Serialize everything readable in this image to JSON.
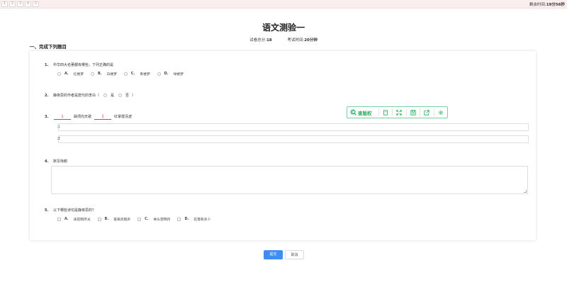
{
  "nav": {
    "question_numbers": [
      "1",
      "2",
      "3",
      "4",
      "5"
    ]
  },
  "timer": {
    "label": "剩余时间:",
    "value": "19分56秒"
  },
  "header": {
    "title": "语文测验一",
    "total_label": "试卷总分:",
    "total_value": "18",
    "time_label": "考试时间:",
    "time_value": "20分钟"
  },
  "section_title": "一、完成下列题目",
  "questions": {
    "q1": {
      "num": "1.",
      "text": "中华四大名著都有哪些，下列正确的是",
      "options": [
        {
          "letter": "A.",
          "text": "红楼梦"
        },
        {
          "letter": "B.",
          "text": "白楼梦"
        },
        {
          "letter": "C.",
          "text": "青楼梦"
        },
        {
          "letter": "D.",
          "text": "绿楼梦"
        }
      ]
    },
    "q2": {
      "num": "2.",
      "text": "静夜思的作者是唐代的李白（",
      "yes": "是",
      "no": "否",
      "close": "）"
    },
    "q3": {
      "num": "3.",
      "blank1": "1",
      "mid": "曲项向天歌",
      "blank2": "2",
      "end": "红掌拨清波",
      "row1": "1",
      "row2": "2"
    },
    "q4": {
      "num": "4.",
      "text": "默写咏鹅"
    },
    "q5": {
      "num": "5.",
      "text": "以下哪些诗句是静夜思的？",
      "options": [
        {
          "letter": "A.",
          "text": "床前明月光"
        },
        {
          "letter": "B.",
          "text": "夜来风雨声"
        },
        {
          "letter": "C.",
          "text": "举头望明月"
        },
        {
          "letter": "D.",
          "text": "花落有多少"
        }
      ]
    }
  },
  "toolbar": {
    "brand": "查版权",
    "icons": [
      "bookmark-icon",
      "fullscreen-icon",
      "save-icon",
      "share-icon",
      "settings-icon"
    ]
  },
  "buttons": {
    "submit": "提交",
    "cancel": "取消"
  },
  "colors": {
    "accent": "#3d8df5",
    "blank": "#e53935",
    "toolbar": "#1aaa55"
  }
}
